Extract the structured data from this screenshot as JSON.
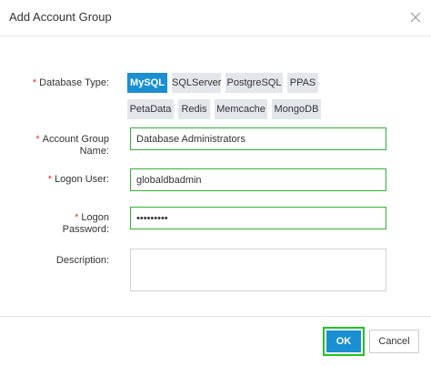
{
  "dialog": {
    "title": "Add Account Group"
  },
  "form": {
    "database_type": {
      "label": "Database Type:",
      "options": [
        "MySQL",
        "SQLServer",
        "PostgreSQL",
        "PPAS",
        "PetaData",
        "Redis",
        "Memcache",
        "MongoDB"
      ],
      "selected": "MySQL"
    },
    "account_group_name": {
      "label_line1": "Account Group",
      "label_line2": "Name:",
      "value": "Database Administrators"
    },
    "logon_user": {
      "label": "Logon User:",
      "value": "globaldbadmin"
    },
    "logon_password": {
      "label_line1": "Logon",
      "label_line2": "Password:",
      "value": "•••••••••"
    },
    "description": {
      "label": "Description:",
      "value": ""
    },
    "required_marker": "*"
  },
  "footer": {
    "ok_label": "OK",
    "cancel_label": "Cancel"
  },
  "colors": {
    "accent": "#1a8fd1",
    "required": "#e0323c",
    "focus_border": "#2fb52f"
  },
  "icons": {
    "close": "close-icon"
  }
}
